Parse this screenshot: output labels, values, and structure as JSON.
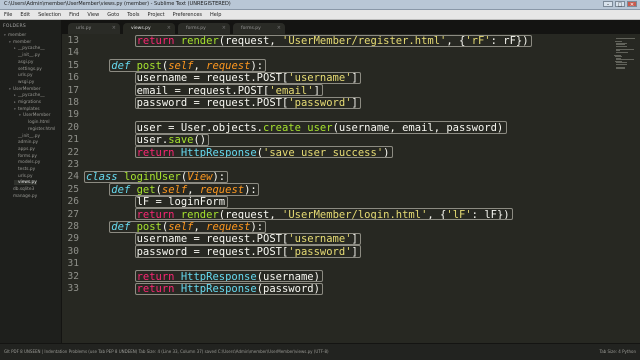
{
  "window": {
    "title": "C:\\Users\\Admin\\member\\UserMember\\views.py (member) - Sublime Text (UNREGISTERED)",
    "buttons": [
      "–",
      "□",
      "✕"
    ]
  },
  "menubar": [
    "File",
    "Edit",
    "Selection",
    "Find",
    "View",
    "Goto",
    "Tools",
    "Project",
    "Preferences",
    "Help"
  ],
  "sidebar": {
    "title": "FOLDERS",
    "items": [
      {
        "label": "member",
        "depth": 0,
        "twisty": "▾"
      },
      {
        "label": "member",
        "depth": 1,
        "twisty": "▾"
      },
      {
        "label": "__pycache__",
        "depth": 2,
        "twisty": "▸"
      },
      {
        "label": "__init__.py",
        "depth": 2,
        "twisty": ""
      },
      {
        "label": "asgi.py",
        "depth": 2,
        "twisty": ""
      },
      {
        "label": "settings.py",
        "depth": 2,
        "twisty": ""
      },
      {
        "label": "urls.py",
        "depth": 2,
        "twisty": ""
      },
      {
        "label": "wsgi.py",
        "depth": 2,
        "twisty": ""
      },
      {
        "label": "UserMember",
        "depth": 1,
        "twisty": "▾"
      },
      {
        "label": "__pycache__",
        "depth": 2,
        "twisty": "▸"
      },
      {
        "label": "migrations",
        "depth": 2,
        "twisty": "▸"
      },
      {
        "label": "templates",
        "depth": 2,
        "twisty": "▾"
      },
      {
        "label": "UserMember",
        "depth": 3,
        "twisty": "▾"
      },
      {
        "label": "login.html",
        "depth": 4,
        "twisty": ""
      },
      {
        "label": "register.html",
        "depth": 4,
        "twisty": ""
      },
      {
        "label": "__init__.py",
        "depth": 2,
        "twisty": ""
      },
      {
        "label": "admin.py",
        "depth": 2,
        "twisty": ""
      },
      {
        "label": "apps.py",
        "depth": 2,
        "twisty": ""
      },
      {
        "label": "forms.py",
        "depth": 2,
        "twisty": ""
      },
      {
        "label": "models.py",
        "depth": 2,
        "twisty": ""
      },
      {
        "label": "tests.py",
        "depth": 2,
        "twisty": ""
      },
      {
        "label": "urls.py",
        "depth": 2,
        "twisty": ""
      },
      {
        "label": "views.py",
        "depth": 2,
        "twisty": "",
        "active": true
      },
      {
        "label": "db.sqlite3",
        "depth": 1,
        "twisty": ""
      },
      {
        "label": "manage.py",
        "depth": 1,
        "twisty": ""
      }
    ]
  },
  "tabs": [
    {
      "label": "urls.py",
      "active": false
    },
    {
      "label": "views.py",
      "active": true
    },
    {
      "label": "forms.py",
      "active": false
    },
    {
      "label": "forms.py",
      "active": false
    }
  ],
  "tab_close_glyph": "×",
  "editor": {
    "lines": [
      {
        "n": "13",
        "tokens": [
          [
            "        ",
            ""
          ],
          [
            "return",
            "kw"
          ],
          [
            " ",
            ""
          ],
          [
            "render",
            "fn"
          ],
          [
            "(request, ",
            ""
          ],
          [
            "'UserMember/register.html'",
            "st"
          ],
          [
            ", {",
            ""
          ],
          [
            "'rF'",
            "st"
          ],
          [
            ": rF})",
            ""
          ]
        ]
      },
      {
        "n": "14",
        "tokens": []
      },
      {
        "n": "15",
        "tokens": [
          [
            "    ",
            ""
          ],
          [
            "def",
            "df"
          ],
          [
            " ",
            ""
          ],
          [
            "post",
            "fn"
          ],
          [
            "(",
            ""
          ],
          [
            "self",
            "sf"
          ],
          [
            ", ",
            ""
          ],
          [
            "request",
            "sf"
          ],
          [
            "):",
            ""
          ]
        ]
      },
      {
        "n": "16",
        "tokens": [
          [
            "        username = request.POST[",
            ""
          ],
          [
            "'username'",
            "st"
          ],
          [
            "]",
            ""
          ]
        ]
      },
      {
        "n": "17",
        "tokens": [
          [
            "        email = request.POST[",
            ""
          ],
          [
            "'email'",
            "st"
          ],
          [
            "]",
            ""
          ]
        ]
      },
      {
        "n": "18",
        "tokens": [
          [
            "        password = request.POST[",
            ""
          ],
          [
            "'password'",
            "st"
          ],
          [
            "]",
            ""
          ]
        ]
      },
      {
        "n": "19",
        "tokens": []
      },
      {
        "n": "20",
        "tokens": [
          [
            "        user = User.objects.",
            ""
          ],
          [
            "create_user",
            "fn"
          ],
          [
            "(username, email, password)",
            ""
          ]
        ]
      },
      {
        "n": "21",
        "tokens": [
          [
            "        user.",
            ""
          ],
          [
            "save",
            "fn"
          ],
          [
            "()",
            ""
          ]
        ]
      },
      {
        "n": "22",
        "tokens": [
          [
            "        ",
            ""
          ],
          [
            "return",
            "kw"
          ],
          [
            " ",
            ""
          ],
          [
            "HttpResponse",
            "bi"
          ],
          [
            "(",
            ""
          ],
          [
            "'save user success'",
            "st"
          ],
          [
            ")",
            ""
          ]
        ]
      },
      {
        "n": "23",
        "tokens": []
      },
      {
        "n": "24",
        "tokens": [
          [
            "class",
            "df"
          ],
          [
            " ",
            ""
          ],
          [
            "loginUser",
            "fn"
          ],
          [
            "(",
            ""
          ],
          [
            "View",
            "sf"
          ],
          [
            "):",
            ""
          ]
        ]
      },
      {
        "n": "25",
        "tokens": [
          [
            "    ",
            ""
          ],
          [
            "def",
            "df"
          ],
          [
            " ",
            ""
          ],
          [
            "get",
            "fn"
          ],
          [
            "(",
            ""
          ],
          [
            "self",
            "sf"
          ],
          [
            ", ",
            ""
          ],
          [
            "request",
            "sf"
          ],
          [
            "):",
            ""
          ]
        ]
      },
      {
        "n": "26",
        "tokens": [
          [
            "        lF = loginForm",
            ""
          ]
        ]
      },
      {
        "n": "27",
        "tokens": [
          [
            "        ",
            ""
          ],
          [
            "return",
            "kw"
          ],
          [
            " ",
            ""
          ],
          [
            "render",
            "fn"
          ],
          [
            "(request, ",
            ""
          ],
          [
            "'UserMember/login.html'",
            "st"
          ],
          [
            ", {",
            ""
          ],
          [
            "'lF'",
            "st"
          ],
          [
            ": lF})",
            ""
          ]
        ]
      },
      {
        "n": "28",
        "tokens": [
          [
            "    ",
            ""
          ],
          [
            "def",
            "df"
          ],
          [
            " ",
            ""
          ],
          [
            "post",
            "fn"
          ],
          [
            "(",
            ""
          ],
          [
            "self",
            "sf"
          ],
          [
            ", ",
            ""
          ],
          [
            "request",
            "sf"
          ],
          [
            "):",
            ""
          ]
        ]
      },
      {
        "n": "29",
        "tokens": [
          [
            "        username = request.POST[",
            ""
          ],
          [
            "'username'",
            "st"
          ],
          [
            "]",
            ""
          ]
        ]
      },
      {
        "n": "30",
        "tokens": [
          [
            "        password = request.POST[",
            ""
          ],
          [
            "'password'",
            "st"
          ],
          [
            "]",
            ""
          ]
        ]
      },
      {
        "n": "31",
        "tokens": []
      },
      {
        "n": "32",
        "tokens": [
          [
            "        ",
            ""
          ],
          [
            "return",
            "kw"
          ],
          [
            " ",
            ""
          ],
          [
            "HttpResponse",
            "bi"
          ],
          [
            "(username)",
            ""
          ]
        ]
      },
      {
        "n": "33",
        "tokens": [
          [
            "        ",
            ""
          ],
          [
            "return",
            "kw"
          ],
          [
            " ",
            ""
          ],
          [
            "HttpResponse",
            "bi"
          ],
          [
            "(password)",
            ""
          ]
        ]
      }
    ]
  },
  "statusbar": {
    "left": "GIt PDF 8 UNSEEN | Indentation Problems (use Tab PEP 8 UNDEEN) Tab Size: 4 (Line 33, Column 37)  saved C:\\Users\\Admin\\member\\UserMember\\views.py (UTF-8)",
    "right": "Tab Size: 4       Python"
  },
  "colors": {
    "editor_bg": "#272822",
    "keyword": "#f92672",
    "function": "#a6e22e",
    "string": "#e6db74",
    "parameter": "#fd971f",
    "storage": "#66d9ef"
  }
}
